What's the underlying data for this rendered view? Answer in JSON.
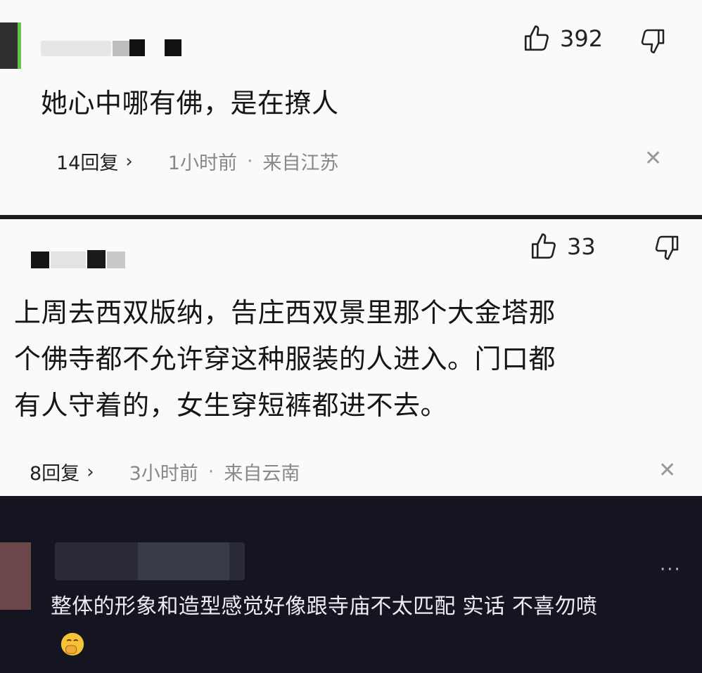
{
  "comments": [
    {
      "likes": "392",
      "text": "她心中哪有佛，是在撩人",
      "replies": "14回复",
      "time": "1小时前",
      "location": "来自江苏"
    },
    {
      "likes": "33",
      "text_lines": [
        "上周去西双版纳，告庄西双景里那个大金塔那",
        "个佛寺都不允许穿这种服装的人进入。门口都",
        "有人守着的，女生穿短裤都进不去。"
      ],
      "replies": "8回复",
      "time": "3小时前",
      "location": "来自云南"
    }
  ],
  "dark_comment": {
    "text": "整体的形象和造型感觉好像跟寺庙不太匹配 实话 不喜勿喷",
    "more": "···",
    "emoji": "face-with-hand-over-mouth-icon"
  },
  "icons": {
    "like": "thumbs-up-outline-icon",
    "dislike": "thumbs-down-outline-icon",
    "chevron": "chevron-right-icon",
    "close": "close-x-icon"
  },
  "colors": {
    "card_bg": "#fafafa",
    "separator": "#1b1b1b",
    "dark_bg": "#141521",
    "dark_text": "#ececf2"
  }
}
